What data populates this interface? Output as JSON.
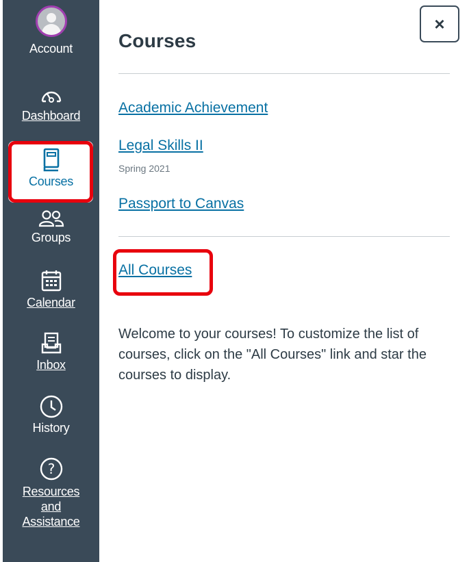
{
  "nav": {
    "account": "Account",
    "dashboard": "Dashboard",
    "courses": "Courses",
    "groups": "Groups",
    "calendar": "Calendar",
    "inbox": "Inbox",
    "history": "History",
    "resources_line1": "Resources",
    "resources_line2": "and",
    "resources_line3": "Assistance"
  },
  "tray": {
    "title": "Courses",
    "close_label": "×",
    "courses": [
      {
        "name": "Academic Achievement",
        "term": ""
      },
      {
        "name": "Legal Skills II",
        "term": "Spring 2021"
      },
      {
        "name": "Passport to Canvas",
        "term": ""
      }
    ],
    "all_courses": "All Courses",
    "welcome": "Welcome to your courses! To customize the list of courses, click on the \"All Courses\" link and star the courses to display."
  },
  "colors": {
    "nav_bg": "#3a4a58",
    "link": "#0770a3",
    "highlight": "#e8000d",
    "avatar_ring": "#a03fb0"
  }
}
